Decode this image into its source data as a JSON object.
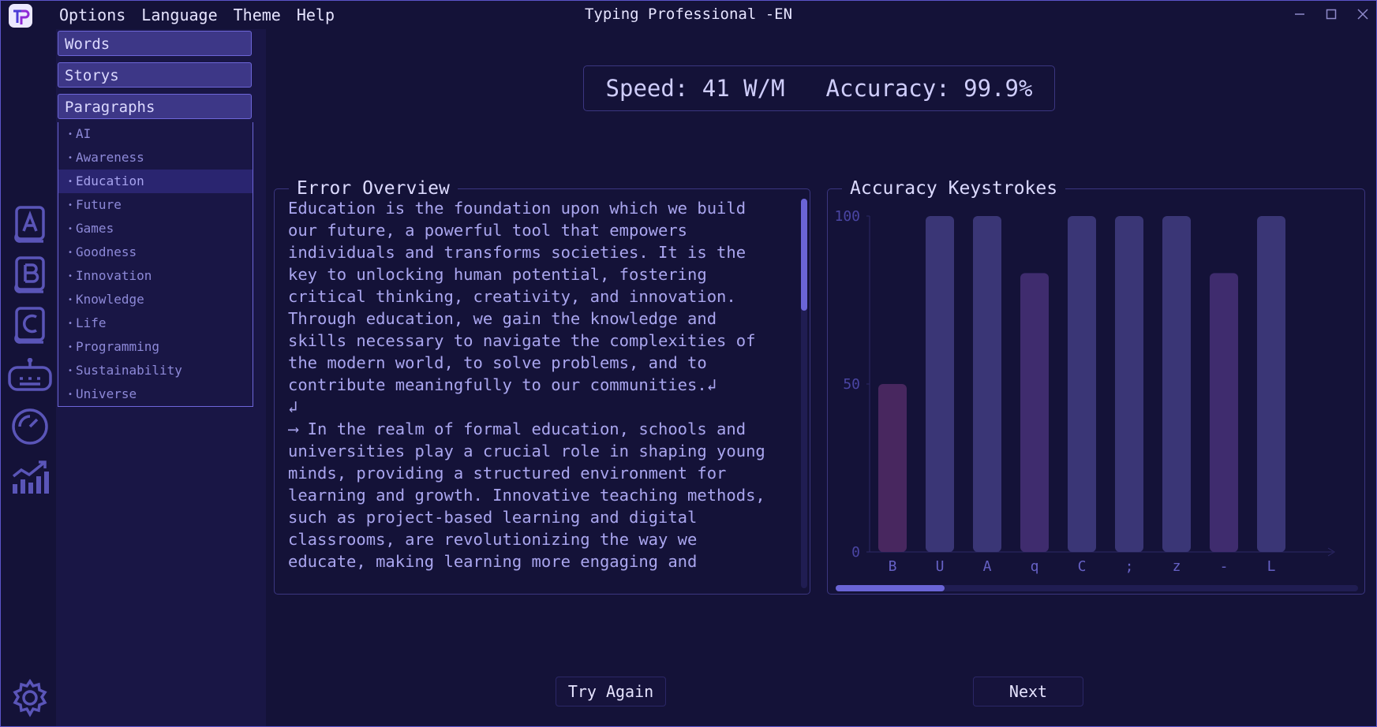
{
  "window": {
    "title": "Typing Professional -EN"
  },
  "menu": [
    "Options",
    "Language",
    "Theme",
    "Help"
  ],
  "rail_icons": [
    "book-a-icon",
    "book-b-icon",
    "book-c-icon",
    "robot-icon",
    "speedometer-icon",
    "chart-icon",
    "settings-icon"
  ],
  "categories": {
    "words": "Words",
    "storys": "Storys",
    "paragraphs": "Paragraphs",
    "items": [
      "AI",
      "Awareness",
      "Education",
      "Future",
      "Games",
      "Goodness",
      "Innovation",
      "Knowledge",
      "Life",
      "Programming",
      "Sustainability",
      "Universe"
    ],
    "selected": "Education"
  },
  "stats": {
    "speed": "Speed: 41 W/M",
    "accuracy": "Accuracy: 99.9%"
  },
  "error_overview": {
    "title": "Error Overview",
    "text": "Education is the foundation upon which we build\nour future, a powerful tool that empowers\nindividuals and transforms societies. It is the\nkey to unlocking human potential, fostering\ncritical thinking, creativity, and innovation.\nThrough education, we gain the knowledge and\nskills necessary to navigate the complexities of\nthe modern world, to solve problems, and to\ncontribute meaningfully to our communities.↲\n↲\n⟶ In the realm of formal education, schools and\nuniversities play a crucial role in shaping young\nminds, providing a structured environment for\nlearning and growth. Innovative teaching methods,\nsuch as project-based learning and digital\nclassrooms, are revolutionizing the way we\neducate, making learning more engaging and"
  },
  "chart_data": {
    "type": "bar",
    "title": "Accuracy Keystrokes",
    "categories": [
      "B",
      "U",
      "A",
      "q",
      "C",
      ";",
      "z",
      "-",
      "L"
    ],
    "values": [
      50,
      100,
      100,
      83,
      100,
      100,
      100,
      83,
      100
    ],
    "ylim": [
      0,
      100
    ],
    "yticks": [
      "0",
      "50",
      "100"
    ],
    "colors": {
      "full": "#3a3676",
      "partial": "#3f2c6e",
      "low": "#48275f"
    }
  },
  "buttons": {
    "try_again": "Try Again",
    "next": "Next"
  }
}
